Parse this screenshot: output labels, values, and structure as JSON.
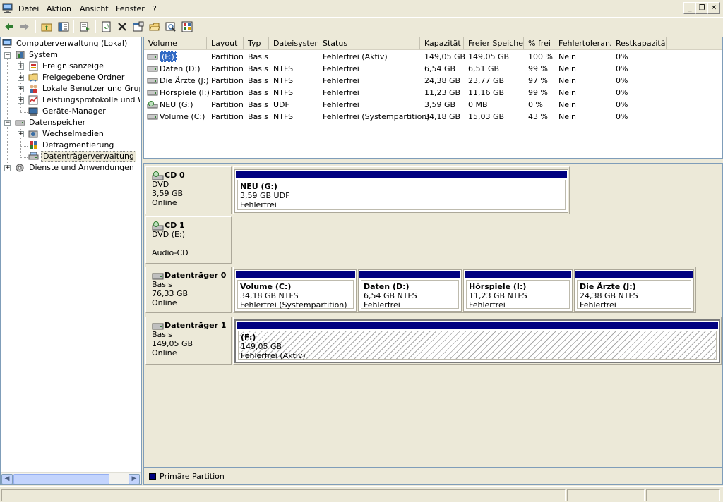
{
  "menu": {
    "items": [
      "Datei",
      "Aktion",
      "Ansicht",
      "Fenster",
      "?"
    ]
  },
  "window_controls": {
    "minimize": "_",
    "restore": "❐",
    "close": "✕"
  },
  "toolbar": {
    "buttons": [
      "back-icon",
      "forward-icon",
      "up-level-icon",
      "show-hide-tree-icon",
      "export-list-icon",
      "refresh-icon",
      "delete-icon",
      "properties-icon",
      "open-icon",
      "search-icon",
      "settings-icon"
    ]
  },
  "tree": {
    "root": "Computerverwaltung (Lokal)",
    "system": "System",
    "ereignisanzeige": "Ereignisanzeige",
    "freigegebene": "Freigegebene Ordner",
    "lokale": "Lokale Benutzer und Gruppen",
    "leistung": "Leistungsprotokolle und Warnungen",
    "geraete": "Geräte-Manager",
    "datenspeicher": "Datenspeicher",
    "wechselmedien": "Wechselmedien",
    "defrag": "Defragmentierung",
    "datentraeger": "Datenträgerverwaltung",
    "dienste": "Dienste und Anwendungen"
  },
  "volume_table": {
    "columns": [
      "Volume",
      "Layout",
      "Typ",
      "Dateisystem",
      "Status",
      "Kapazität",
      "Freier Speicher",
      "% frei",
      "Fehlertoleranz",
      "Restkapazität"
    ],
    "rows": [
      [
        "(F:)",
        "Partition",
        "Basis",
        "",
        "Fehlerfrei (Aktiv)",
        "149,05 GB",
        "149,05 GB",
        "100 %",
        "Nein",
        "0%"
      ],
      [
        "Daten (D:)",
        "Partition",
        "Basis",
        "NTFS",
        "Fehlerfrei",
        "6,54 GB",
        "6,51 GB",
        "99 %",
        "Nein",
        "0%"
      ],
      [
        "Die Ärzte (J:)",
        "Partition",
        "Basis",
        "NTFS",
        "Fehlerfrei",
        "24,38 GB",
        "23,77 GB",
        "97 %",
        "Nein",
        "0%"
      ],
      [
        "Hörspiele (I:)",
        "Partition",
        "Basis",
        "NTFS",
        "Fehlerfrei",
        "11,23 GB",
        "11,16 GB",
        "99 %",
        "Nein",
        "0%"
      ],
      [
        "NEU (G:)",
        "Partition",
        "Basis",
        "UDF",
        "Fehlerfrei",
        "3,59 GB",
        "0 MB",
        "0 %",
        "Nein",
        "0%"
      ],
      [
        "Volume (C:)",
        "Partition",
        "Basis",
        "NTFS",
        "Fehlerfrei (Systempartition)",
        "34,18 GB",
        "15,03 GB",
        "43 %",
        "Nein",
        "0%"
      ]
    ],
    "row_icons": [
      "disk-icon",
      "disk-icon",
      "disk-icon",
      "disk-icon",
      "cd-icon",
      "disk-icon"
    ]
  },
  "disks": {
    "cd0": {
      "name": "CD 0",
      "line1": "DVD",
      "line2": "3,59 GB",
      "line3": "Online",
      "part": {
        "title": "NEU  (G:)",
        "size": "3,59 GB UDF",
        "status": "Fehlerfrei"
      }
    },
    "cd1": {
      "name": "CD 1",
      "line1": "DVD (E:)",
      "line3": "Audio-CD"
    },
    "d0": {
      "name": "Datenträger 0",
      "line1": "Basis",
      "line2": "76,33 GB",
      "line3": "Online",
      "parts": [
        {
          "title": "Volume  (C:)",
          "size": "34,18 GB NTFS",
          "status": "Fehlerfrei (Systempartition)"
        },
        {
          "title": "Daten  (D:)",
          "size": "6,54 GB NTFS",
          "status": "Fehlerfrei"
        },
        {
          "title": "Hörspiele  (I:)",
          "size": "11,23 GB NTFS",
          "status": "Fehlerfrei"
        },
        {
          "title": "Die Ärzte  (J:)",
          "size": "24,38 GB NTFS",
          "status": "Fehlerfrei"
        }
      ]
    },
    "d1": {
      "name": "Datenträger 1",
      "line1": "Basis",
      "line2": "149,05 GB",
      "line3": "Online",
      "part": {
        "title": "(F:)",
        "size": "149,05 GB",
        "status": "Fehlerfrei (Aktiv)"
      }
    }
  },
  "legend": {
    "label": "Primäre Partition",
    "color": "#000080"
  },
  "colors": {
    "partition_bar": "#000080",
    "selection": "#316ac5",
    "background": "#ece9d8"
  }
}
